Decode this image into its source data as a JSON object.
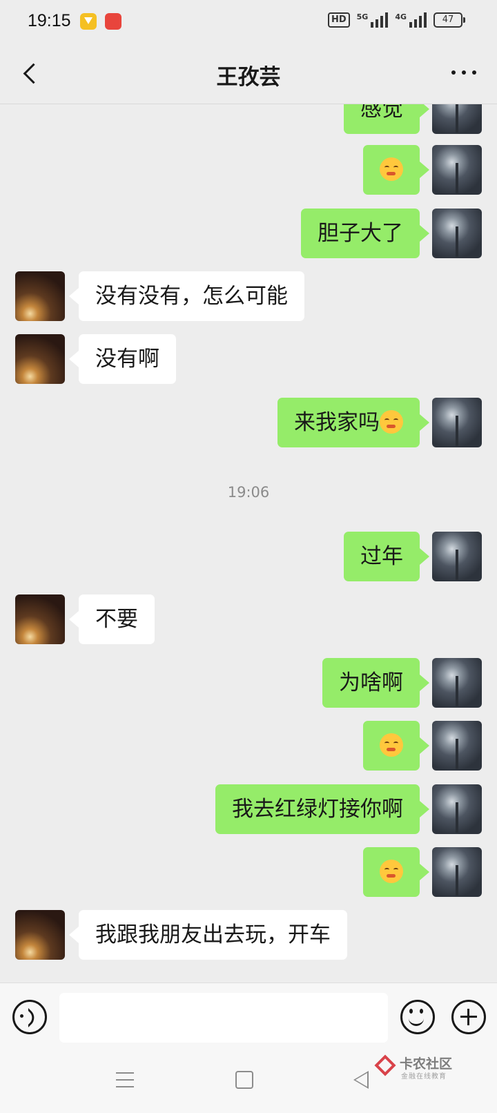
{
  "status_bar": {
    "time": "19:15",
    "hd_label": "HD",
    "network_5g": "5G",
    "network_4g": "4G",
    "battery": "47"
  },
  "header": {
    "title": "王孜芸"
  },
  "messages": [
    {
      "side": "me",
      "text": "感觉",
      "emoji": false
    },
    {
      "side": "me",
      "text": "",
      "emoji": true
    },
    {
      "side": "me",
      "text": "胆子大了",
      "emoji": false
    },
    {
      "side": "other",
      "text": "没有没有，怎么可能",
      "emoji": false
    },
    {
      "side": "other",
      "text": "没有啊",
      "emoji": false
    },
    {
      "side": "me",
      "text": "来我家吗",
      "emoji": true
    },
    {
      "side": "me",
      "text": "过年",
      "emoji": false
    },
    {
      "side": "other",
      "text": "不要",
      "emoji": false
    },
    {
      "side": "me",
      "text": "为啥啊",
      "emoji": false
    },
    {
      "side": "me",
      "text": "",
      "emoji": true
    },
    {
      "side": "me",
      "text": "我去红绿灯接你啊",
      "emoji": false
    },
    {
      "side": "me",
      "text": "",
      "emoji": true
    },
    {
      "side": "other",
      "text": "我跟我朋友出去玩，开车",
      "emoji": false
    }
  ],
  "timestamp": "19:06",
  "input": {
    "value": "",
    "placeholder": ""
  },
  "watermark": {
    "title": "卡农社区",
    "subtitle": "金融在线教育"
  },
  "colors": {
    "background": "#ededed",
    "my_bubble": "#95ec69",
    "other_bubble": "#ffffff"
  }
}
